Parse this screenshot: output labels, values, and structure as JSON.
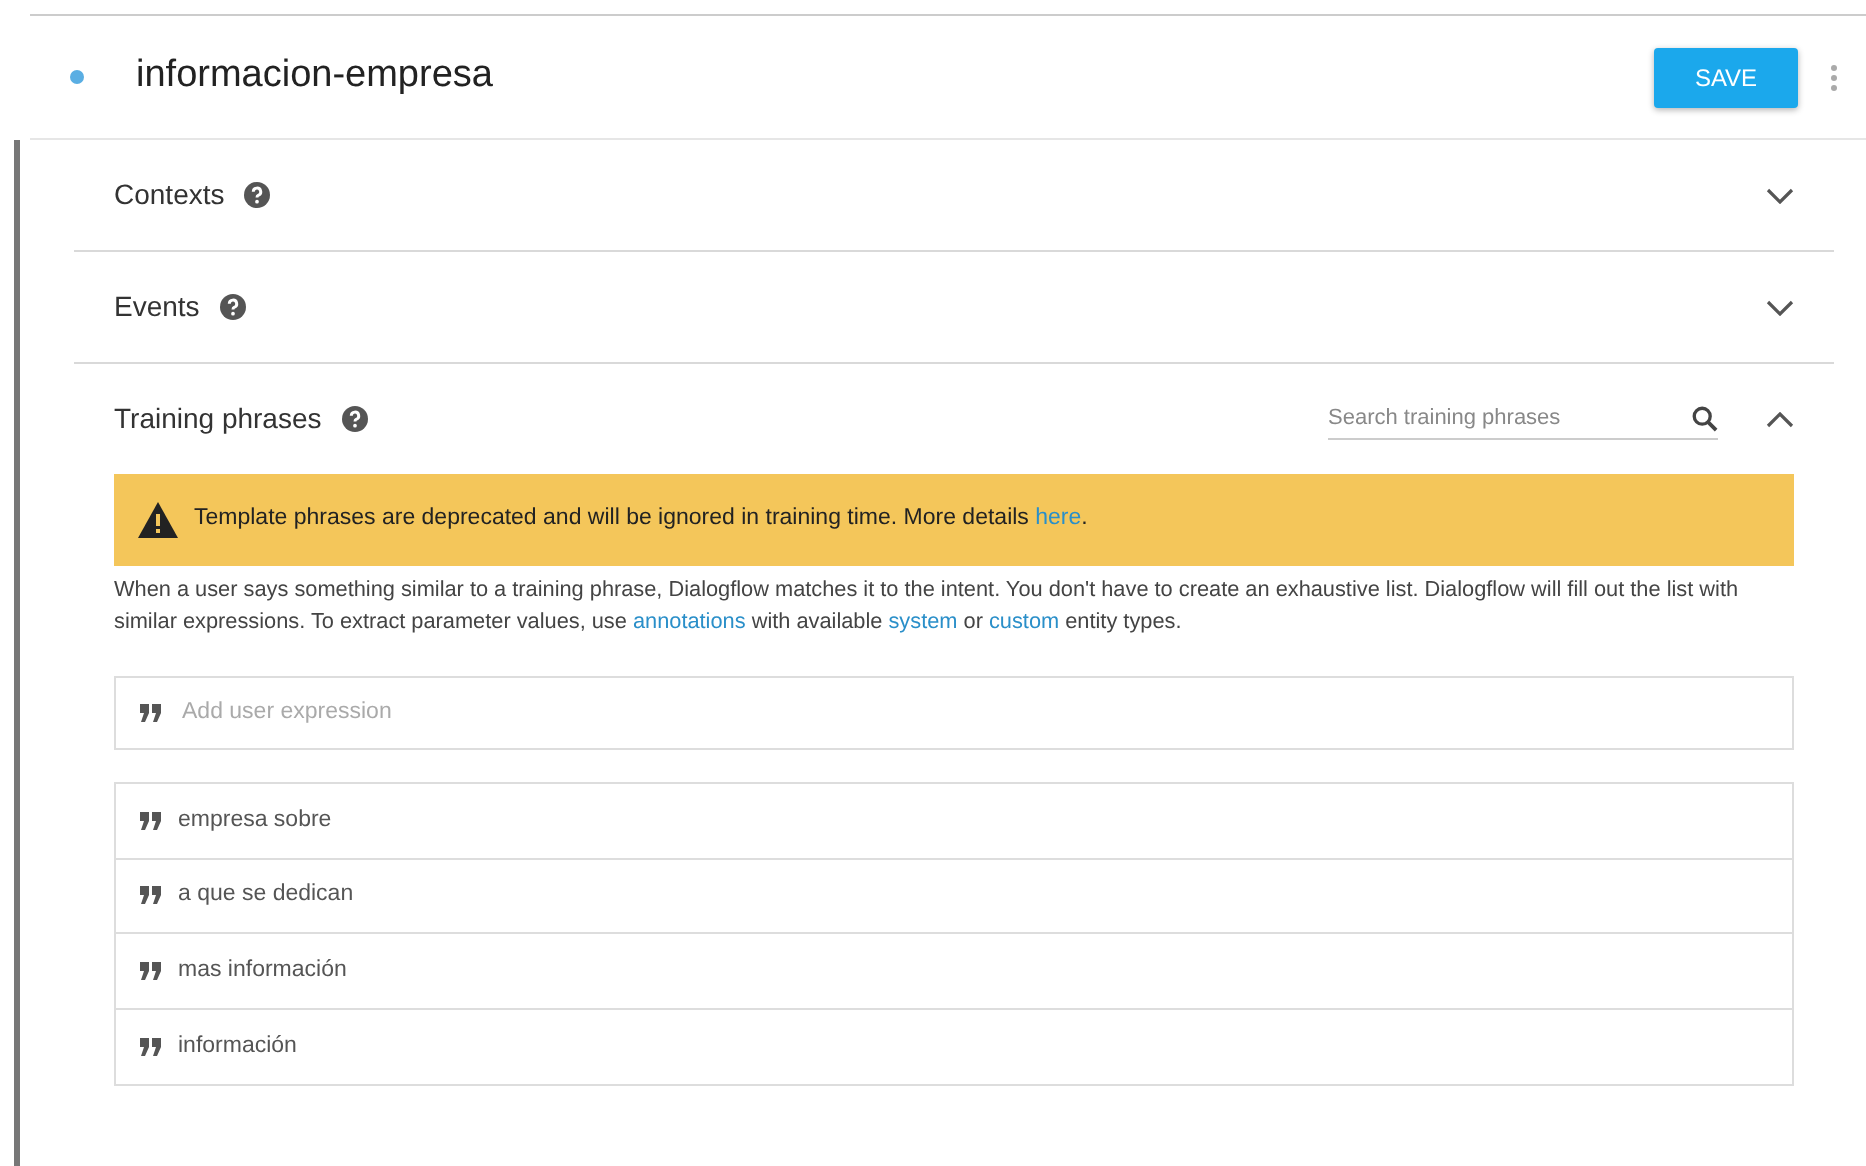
{
  "intent": {
    "name": "informacion-empresa",
    "save_label": "SAVE"
  },
  "sections": [
    {
      "title": "Contexts",
      "expanded": false
    },
    {
      "title": "Events",
      "expanded": false
    },
    {
      "title": "Training phrases",
      "expanded": true
    }
  ],
  "training": {
    "search": {
      "placeholder": "Search training phrases"
    },
    "warning": [
      {
        "kind": "text",
        "text": "Template phrases are deprecated and will be ignored in training time. More details "
      },
      {
        "kind": "link",
        "text": "here"
      },
      {
        "kind": "text",
        "text": "."
      }
    ],
    "description": [
      {
        "kind": "text",
        "text": "When a user says something similar to a training phrase, Dialogflow matches it to the intent. You don't have to create an exhaustive list. Dialogflow will fill out the list with similar expressions. To extract parameter values, use "
      },
      {
        "kind": "link",
        "text": "annotations"
      },
      {
        "kind": "text",
        "text": " with available "
      },
      {
        "kind": "link",
        "text": "system"
      },
      {
        "kind": "text",
        "text": " or "
      },
      {
        "kind": "link",
        "text": "custom"
      },
      {
        "kind": "text",
        "text": " entity types."
      }
    ],
    "add": {
      "placeholder": "Add user expression"
    },
    "phrases": [
      "empresa sobre",
      "a que se dedican",
      "mas información",
      "información"
    ]
  }
}
